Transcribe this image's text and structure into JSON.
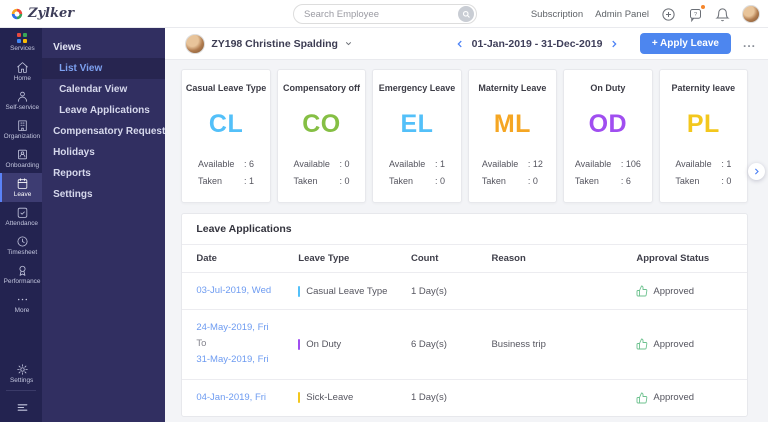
{
  "topbar": {
    "logo_text": "Zylker",
    "search_placeholder": "Search Employee",
    "subscription_label": "Subscription",
    "admin_panel_label": "Admin Panel",
    "icons": [
      "plus-circle-icon",
      "help-chat-icon",
      "bell-icon",
      "user-avatar"
    ]
  },
  "rail": {
    "items": [
      {
        "label": "Services",
        "icon": "services-grid-icon",
        "active": false
      },
      {
        "label": "Home",
        "icon": "home-icon",
        "active": false
      },
      {
        "label": "Self-service",
        "icon": "person-icon",
        "active": false
      },
      {
        "label": "Organization",
        "icon": "building-icon",
        "active": false
      },
      {
        "label": "Onboarding",
        "icon": "badge-icon",
        "active": false
      },
      {
        "label": "Leave",
        "icon": "calendar-icon",
        "active": true
      },
      {
        "label": "Attendance",
        "icon": "calendar-check-icon",
        "active": false
      },
      {
        "label": "Timesheet",
        "icon": "clock-icon",
        "active": false
      },
      {
        "label": "Performance",
        "icon": "medal-icon",
        "active": false
      },
      {
        "label": "More",
        "icon": "ellipsis-icon",
        "active": false
      }
    ],
    "bottom_items": [
      {
        "label": "Settings",
        "icon": "gear-icon",
        "active": false
      }
    ],
    "collapse_icon": "hamburger-collapse-icon"
  },
  "subnav": {
    "section_label": "Views",
    "view_items": [
      {
        "label": "List View",
        "active": true
      },
      {
        "label": "Calendar View",
        "active": false
      },
      {
        "label": "Leave Applications",
        "active": false
      }
    ],
    "items": [
      {
        "label": "Compensatory Request"
      },
      {
        "label": "Holidays"
      },
      {
        "label": "Reports"
      },
      {
        "label": "Settings"
      }
    ]
  },
  "header": {
    "employee": "ZY198 Christine Spalding",
    "date_range": "01-Jan-2019 - 31-Dec-2019",
    "apply_leave_label": "+ Apply Leave",
    "more_label": "..."
  },
  "cards_labels": {
    "available": "Available",
    "taken": "Taken"
  },
  "cards": [
    {
      "title": "Casual Leave Type",
      "code": "CL",
      "color": "#53c0f9",
      "available": "6",
      "taken": "1"
    },
    {
      "title": "Compensatory off",
      "code": "CO",
      "color": "#85bf44",
      "available": "0",
      "taken": "0"
    },
    {
      "title": "Emergency Leave",
      "code": "EL",
      "color": "#53c0f9",
      "available": "1",
      "taken": "0"
    },
    {
      "title": "Maternity Leave",
      "code": "ML",
      "color": "#f5a623",
      "available": "12",
      "taken": "0"
    },
    {
      "title": "On Duty",
      "code": "OD",
      "color": "#a04ef0",
      "available": "106",
      "taken": "6"
    },
    {
      "title": "Paternity leave",
      "code": "PL",
      "color": "#f3c71d",
      "available": "1",
      "taken": "0"
    }
  ],
  "table": {
    "title": "Leave Applications",
    "columns": [
      "Date",
      "Leave Type",
      "Count",
      "Reason",
      "Approval Status"
    ],
    "rows": [
      {
        "dates": [
          "03-Jul-2019, Wed"
        ],
        "type": "Casual Leave Type",
        "type_color": "#53c0f9",
        "count": "1 Day(s)",
        "reason": "",
        "status": "Approved",
        "status_icon": "thumbs-up-icon"
      },
      {
        "dates": [
          "24-May-2019, Fri",
          "To",
          "31-May-2019, Fri"
        ],
        "type": "On Duty",
        "type_color": "#a04ef0",
        "count": "6 Day(s)",
        "reason": "Business trip",
        "status": "Approved",
        "status_icon": "thumbs-up-icon"
      },
      {
        "dates": [
          "04-Jan-2019, Fri"
        ],
        "type": "Sick-Leave",
        "type_color": "#f3c71d",
        "count": "1 Day(s)",
        "reason": "",
        "status": "Approved",
        "status_icon": "thumbs-up-icon"
      }
    ],
    "status_color": "#6cc18e"
  }
}
